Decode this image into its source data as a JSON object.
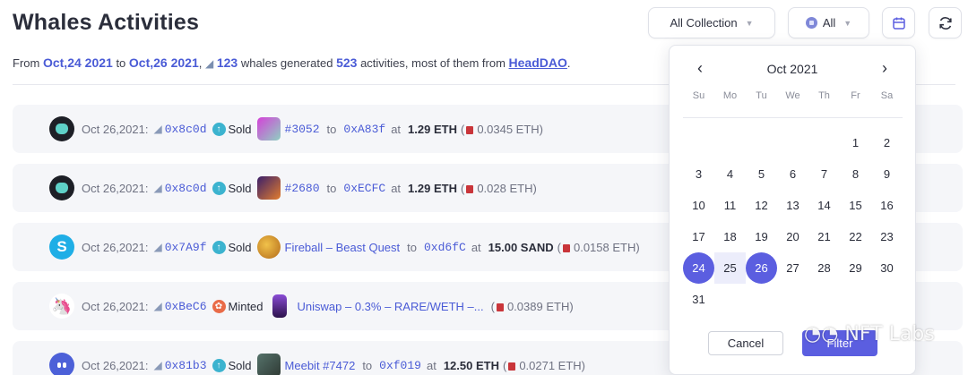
{
  "header": {
    "title": "Whales Activities",
    "summary": {
      "from_label": "From",
      "date_from": "Oct,24 2021",
      "to_label": "to",
      "date_to": "Oct,26 2021",
      "whale_count": "123",
      "mid_text": "whales generated",
      "activity_count": "523",
      "tail_text": "activities, most of them from",
      "top_collection": "HeadDAO"
    }
  },
  "filters": {
    "collection_label": "All Collection",
    "chain_label": "All"
  },
  "activities": [
    {
      "date": "Oct 26,2021:",
      "whale": "0x8c0d",
      "action": "Sold",
      "item": "#3052",
      "to_label": "to",
      "to_addr": "0xA83f",
      "at_label": "at",
      "price": "1.29 ETH",
      "gas": "0.0345 ETH)"
    },
    {
      "date": "Oct 26,2021:",
      "whale": "0x8c0d",
      "action": "Sold",
      "item": "#2680",
      "to_label": "to",
      "to_addr": "0xECFC",
      "at_label": "at",
      "price": "1.29 ETH",
      "gas": "0.028 ETH)"
    },
    {
      "date": "Oct 26,2021:",
      "whale": "0x7A9f",
      "action": "Sold",
      "item": "Fireball – Beast Quest",
      "to_label": "to",
      "to_addr": "0xd6fC",
      "at_label": "at",
      "price": "15.00 SAND",
      "gas": "0.0158 ETH)"
    },
    {
      "date": "Oct 26,2021:",
      "whale": "0xBeC6",
      "action": "Minted",
      "item": "Uniswap – 0.3% – RARE/WETH –...",
      "gas": "0.0389 ETH)"
    },
    {
      "date": "Oct 26,2021:",
      "whale": "0x81b3",
      "action": "Sold",
      "item": "Meebit #7472",
      "to_label": "to",
      "to_addr": "0xf019",
      "at_label": "at",
      "price": "12.50 ETH",
      "gas": "0.0271 ETH)"
    }
  ],
  "calendar": {
    "month": "Oct 2021",
    "weekdays": [
      "Su",
      "Mo",
      "Tu",
      "We",
      "Th",
      "Fr",
      "Sa"
    ],
    "days": [
      "1",
      "2",
      "3",
      "4",
      "5",
      "6",
      "7",
      "8",
      "9",
      "10",
      "11",
      "12",
      "13",
      "14",
      "15",
      "16",
      "17",
      "18",
      "19",
      "20",
      "21",
      "22",
      "23",
      "24",
      "25",
      "26",
      "27",
      "28",
      "29",
      "30",
      "31"
    ],
    "selected_start": "24",
    "selected_end": "26",
    "cancel_label": "Cancel",
    "filter_label": "Filter"
  },
  "watermark": "NFT Labs",
  "colors": {
    "accent": "#5b5ee0",
    "link": "#4a5bd6",
    "row_bg": "#f5f6f9"
  }
}
